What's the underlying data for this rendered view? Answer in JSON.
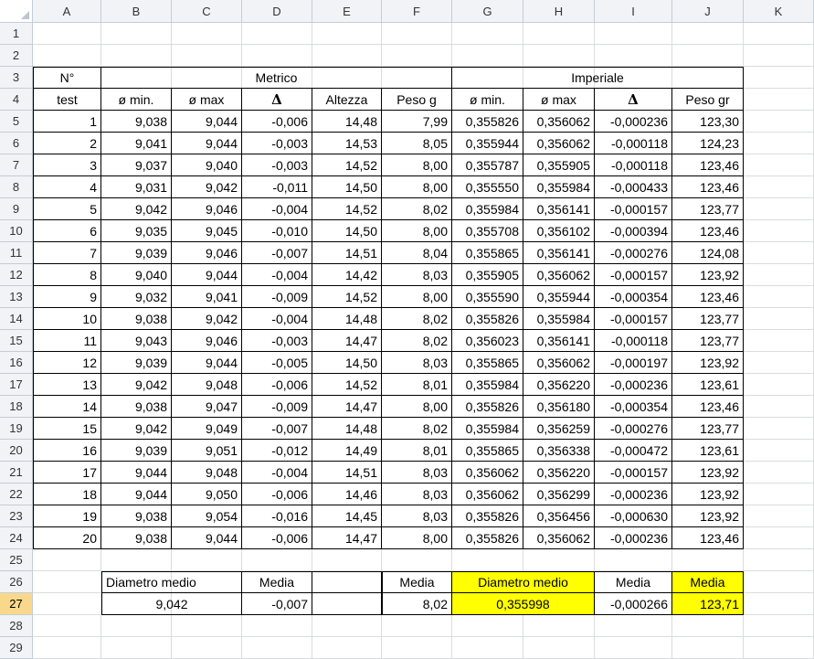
{
  "columns": [
    "A",
    "B",
    "C",
    "D",
    "E",
    "F",
    "G",
    "H",
    "I",
    "J",
    "K"
  ],
  "rows": [
    "1",
    "2",
    "3",
    "4",
    "5",
    "6",
    "7",
    "8",
    "9",
    "10",
    "11",
    "12",
    "13",
    "14",
    "15",
    "16",
    "17",
    "18",
    "19",
    "20",
    "21",
    "22",
    "23",
    "24",
    "25",
    "26",
    "27",
    "28",
    "29"
  ],
  "selected": {
    "column": "",
    "row": "27"
  },
  "header": {
    "n_label": "N°",
    "test_label": "test",
    "metrico": "Metrico",
    "imperiale": "Imperiale",
    "metric_cols": [
      "ø min.",
      "ø max",
      "Δ",
      "Altezza",
      "Peso g"
    ],
    "imperial_cols": [
      "ø min.",
      "ø max",
      "Δ",
      "Peso gr"
    ]
  },
  "data": [
    [
      "1",
      "9,038",
      "9,044",
      "-0,006",
      "14,48",
      "7,99",
      "0,355826",
      "0,356062",
      "-0,000236",
      "123,30"
    ],
    [
      "2",
      "9,041",
      "9,044",
      "-0,003",
      "14,53",
      "8,05",
      "0,355944",
      "0,356062",
      "-0,000118",
      "124,23"
    ],
    [
      "3",
      "9,037",
      "9,040",
      "-0,003",
      "14,52",
      "8,00",
      "0,355787",
      "0,355905",
      "-0,000118",
      "123,46"
    ],
    [
      "4",
      "9,031",
      "9,042",
      "-0,011",
      "14,50",
      "8,00",
      "0,355550",
      "0,355984",
      "-0,000433",
      "123,46"
    ],
    [
      "5",
      "9,042",
      "9,046",
      "-0,004",
      "14,52",
      "8,02",
      "0,355984",
      "0,356141",
      "-0,000157",
      "123,77"
    ],
    [
      "6",
      "9,035",
      "9,045",
      "-0,010",
      "14,50",
      "8,00",
      "0,355708",
      "0,356102",
      "-0,000394",
      "123,46"
    ],
    [
      "7",
      "9,039",
      "9,046",
      "-0,007",
      "14,51",
      "8,04",
      "0,355865",
      "0,356141",
      "-0,000276",
      "124,08"
    ],
    [
      "8",
      "9,040",
      "9,044",
      "-0,004",
      "14,42",
      "8,03",
      "0,355905",
      "0,356062",
      "-0,000157",
      "123,92"
    ],
    [
      "9",
      "9,032",
      "9,041",
      "-0,009",
      "14,52",
      "8,00",
      "0,355590",
      "0,355944",
      "-0,000354",
      "123,46"
    ],
    [
      "10",
      "9,038",
      "9,042",
      "-0,004",
      "14,48",
      "8,02",
      "0,355826",
      "0,355984",
      "-0,000157",
      "123,77"
    ],
    [
      "11",
      "9,043",
      "9,046",
      "-0,003",
      "14,47",
      "8,02",
      "0,356023",
      "0,356141",
      "-0,000118",
      "123,77"
    ],
    [
      "12",
      "9,039",
      "9,044",
      "-0,005",
      "14,50",
      "8,03",
      "0,355865",
      "0,356062",
      "-0,000197",
      "123,92"
    ],
    [
      "13",
      "9,042",
      "9,048",
      "-0,006",
      "14,52",
      "8,01",
      "0,355984",
      "0,356220",
      "-0,000236",
      "123,61"
    ],
    [
      "14",
      "9,038",
      "9,047",
      "-0,009",
      "14,47",
      "8,00",
      "0,355826",
      "0,356180",
      "-0,000354",
      "123,46"
    ],
    [
      "15",
      "9,042",
      "9,049",
      "-0,007",
      "14,48",
      "8,02",
      "0,355984",
      "0,356259",
      "-0,000276",
      "123,77"
    ],
    [
      "16",
      "9,039",
      "9,051",
      "-0,012",
      "14,49",
      "8,01",
      "0,355865",
      "0,356338",
      "-0,000472",
      "123,61"
    ],
    [
      "17",
      "9,044",
      "9,048",
      "-0,004",
      "14,51",
      "8,03",
      "0,356062",
      "0,356220",
      "-0,000157",
      "123,92"
    ],
    [
      "18",
      "9,044",
      "9,050",
      "-0,006",
      "14,46",
      "8,03",
      "0,356062",
      "0,356299",
      "-0,000236",
      "123,92"
    ],
    [
      "19",
      "9,038",
      "9,054",
      "-0,016",
      "14,45",
      "8,03",
      "0,355826",
      "0,356456",
      "-0,000630",
      "123,92"
    ],
    [
      "20",
      "9,038",
      "9,044",
      "-0,006",
      "14,47",
      "8,00",
      "0,355826",
      "0,356062",
      "-0,000236",
      "123,46"
    ]
  ],
  "summary": {
    "labels": [
      "Diametro medio",
      "Media",
      "Media",
      "Diametro medio",
      "Media",
      "Media"
    ],
    "values": [
      "9,042",
      "-0,007",
      "8,02",
      "0,355998",
      "-0,000266",
      "123,71"
    ]
  },
  "colors": {
    "highlight": "#ffff00",
    "selected_header": "#f8d98c",
    "header_bg": "#f1f3f6",
    "gridline": "#dadcdd"
  }
}
